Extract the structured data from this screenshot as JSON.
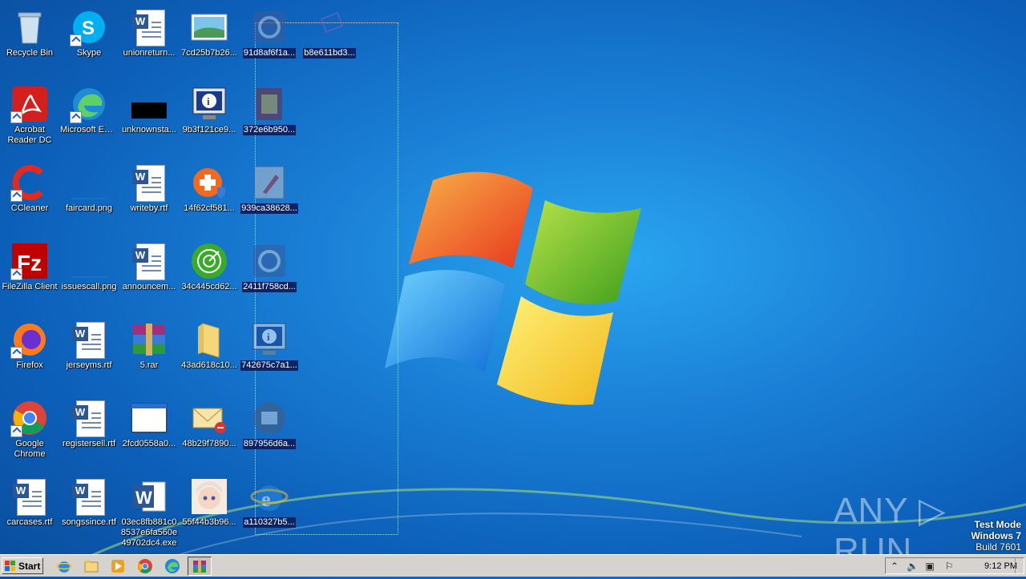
{
  "desktop": {
    "icons": [
      {
        "label": "Recycle Bin"
      },
      {
        "label": "Skype"
      },
      {
        "label": "unionreturn..."
      },
      {
        "label": "7cd25b7b26..."
      },
      {
        "label": "91d8af6f1a..."
      },
      {
        "label": "b8e611bd3..."
      },
      {
        "label": "Acrobat Reader DC"
      },
      {
        "label": "Microsoft Edge"
      },
      {
        "label": "unknownsta..."
      },
      {
        "label": "9b3f121ce9..."
      },
      {
        "label": "372e6b950..."
      },
      {
        "label": "CCleaner"
      },
      {
        "label": "faircard.png"
      },
      {
        "label": "writeby.rtf"
      },
      {
        "label": "14f62cf581..."
      },
      {
        "label": "939ca38628..."
      },
      {
        "label": "FileZilla Client"
      },
      {
        "label": "issuescall.png"
      },
      {
        "label": "announcem..."
      },
      {
        "label": "34c445cd62..."
      },
      {
        "label": "2411f758cd..."
      },
      {
        "label": "Firefox"
      },
      {
        "label": "jerseyms.rtf"
      },
      {
        "label": "5.rar"
      },
      {
        "label": "43ad618c10..."
      },
      {
        "label": "742675c7a1..."
      },
      {
        "label": "Google Chrome"
      },
      {
        "label": "registersell.rtf"
      },
      {
        "label": "2fcd0558a0..."
      },
      {
        "label": "48b29f7890..."
      },
      {
        "label": "897956d6a..."
      },
      {
        "label": "carcases.rtf"
      },
      {
        "label": "songssince.rtf"
      },
      {
        "label": "03ec8fb881c08537e6fa560e49702dc4.exe"
      },
      {
        "label": "55f44b3b96..."
      },
      {
        "label": "a110327b5..."
      }
    ]
  },
  "watermark": {
    "text": "ANY ▷ RUN"
  },
  "os_info": {
    "mode": "Test Mode",
    "version": "Windows 7",
    "build": "Build 7601"
  },
  "taskbar": {
    "start_label": "Start",
    "clock": "9:12 PM"
  },
  "colors": {
    "taskbar": "#d6d3ce",
    "selection": "#0a246a",
    "desktop": "#1a7fd6"
  }
}
